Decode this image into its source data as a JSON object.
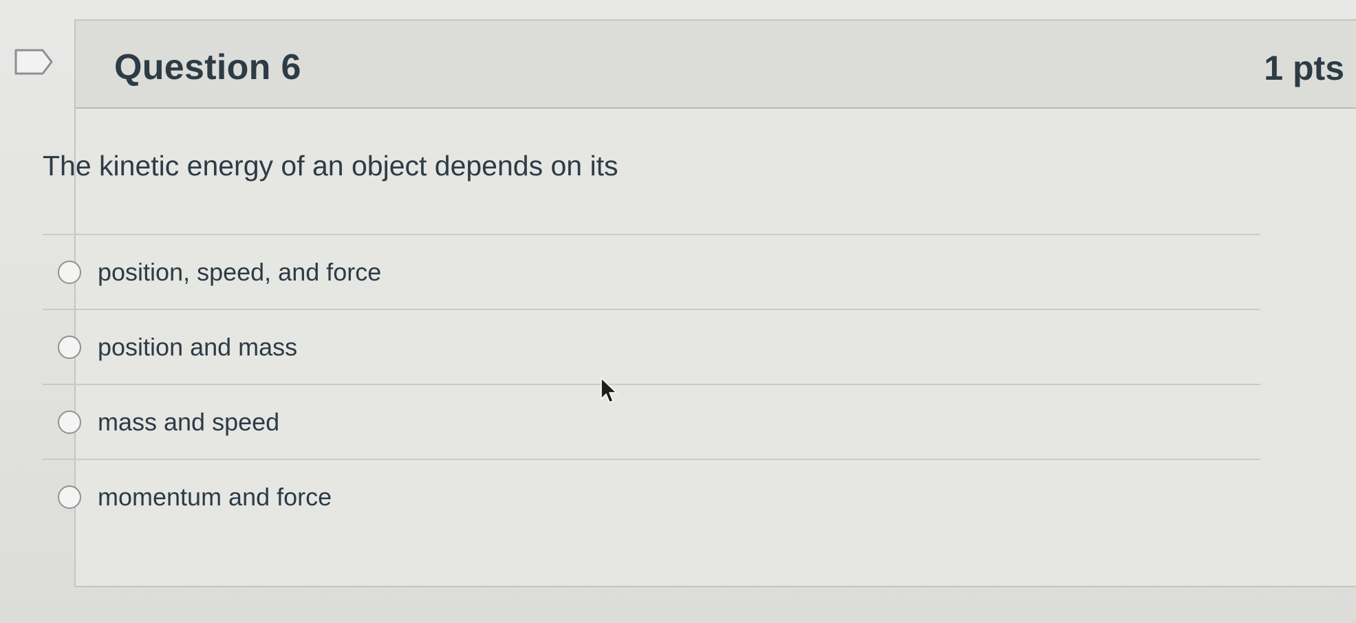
{
  "question": {
    "title": "Question 6",
    "points": "1 pts",
    "text": "The kinetic energy of an object depends on its"
  },
  "answers": [
    {
      "label": "position, speed, and force",
      "selected": false
    },
    {
      "label": "position and mass",
      "selected": false
    },
    {
      "label": "mass and speed",
      "selected": false
    },
    {
      "label": "momentum and force",
      "selected": false
    }
  ],
  "icons": {
    "flag": "flag-question-icon",
    "cursor": "mouse-pointer-icon"
  }
}
